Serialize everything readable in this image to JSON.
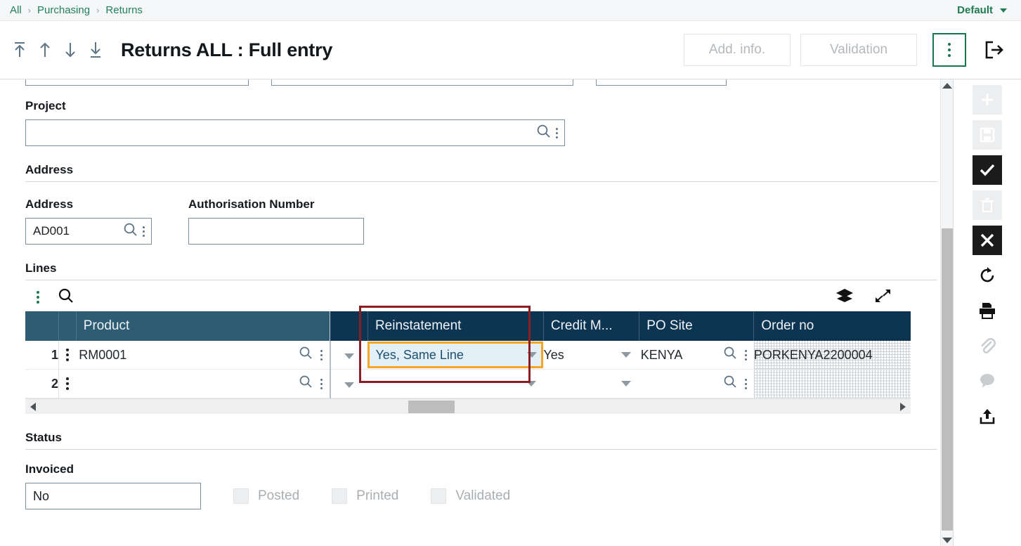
{
  "breadcrumb": {
    "items": [
      "All",
      "Purchasing",
      "Returns"
    ],
    "separator": "›",
    "right_selector": "Default"
  },
  "header": {
    "title": "Returns ALL : Full entry",
    "nav_icons": [
      "first-record-icon",
      "previous-record-icon",
      "next-record-icon",
      "last-record-icon"
    ],
    "buttons": [
      {
        "label": "Add. info.",
        "state": "disabled"
      },
      {
        "label": "Validation",
        "state": "disabled"
      }
    ],
    "more_actions_icon": "kebab-menu-icon",
    "exit_icon": "exit-icon",
    "accent_green": "#17764d"
  },
  "form": {
    "project": {
      "label": "Project",
      "value": "",
      "search_icon": "search-icon",
      "kebab_icon": "kebab-menu-icon"
    },
    "address_section": {
      "title": "Address",
      "address": {
        "label": "Address",
        "value": "AD001",
        "search_icon": "search-icon",
        "kebab_icon": "kebab-menu-icon"
      },
      "authorisation_number": {
        "label": "Authorisation Number",
        "value": ""
      }
    },
    "lines_section": {
      "title": "Lines",
      "toolbar": {
        "kebab_icon": "kebab-menu-icon",
        "search_icon": "search-icon",
        "layers_icon": "layers-icon",
        "expand_icon": "expand-icon"
      },
      "columns": [
        "",
        "",
        "Product",
        "",
        "Reinstatement",
        "Credit M...",
        "PO Site",
        "Order no"
      ],
      "rows": [
        {
          "num": "1",
          "product": "RM0001",
          "reinstatement": "Yes, Same Line",
          "credit_memo": "Yes",
          "po_site": "KENYA",
          "order_no": "PORKENYA2200004"
        },
        {
          "num": "2",
          "product": "",
          "reinstatement": "",
          "credit_memo": "",
          "po_site": "",
          "order_no": ""
        }
      ],
      "highlighted_cell": {
        "column": "Reinstatement",
        "row": "1",
        "value": "Yes, Same Line",
        "focus_color": "#f5a623",
        "annotation_color": "#8c1d23"
      }
    },
    "status_section": {
      "title": "Status",
      "invoiced": {
        "label": "Invoiced",
        "value": "No"
      },
      "checkboxes": [
        {
          "label": "Posted",
          "checked": false
        },
        {
          "label": "Printed",
          "checked": false
        },
        {
          "label": "Validated",
          "checked": false
        }
      ]
    }
  },
  "right_rail": {
    "items": [
      {
        "name": "add-icon",
        "state": "disabled"
      },
      {
        "name": "save-icon",
        "state": "disabled"
      },
      {
        "name": "confirm-check-icon",
        "state": "active"
      },
      {
        "name": "delete-trash-icon",
        "state": "disabled"
      },
      {
        "name": "cancel-close-icon",
        "state": "active"
      },
      {
        "name": "refresh-icon",
        "state": "enabled"
      },
      {
        "name": "print-icon",
        "state": "enabled"
      },
      {
        "name": "attachment-paperclip-icon",
        "state": "disabled"
      },
      {
        "name": "comment-icon",
        "state": "disabled"
      },
      {
        "name": "share-export-icon",
        "state": "enabled"
      }
    ]
  },
  "scrollbars": {
    "grid_horizontal": {
      "position_pct": 43
    },
    "page_vertical": {
      "position_pct": 33
    }
  }
}
